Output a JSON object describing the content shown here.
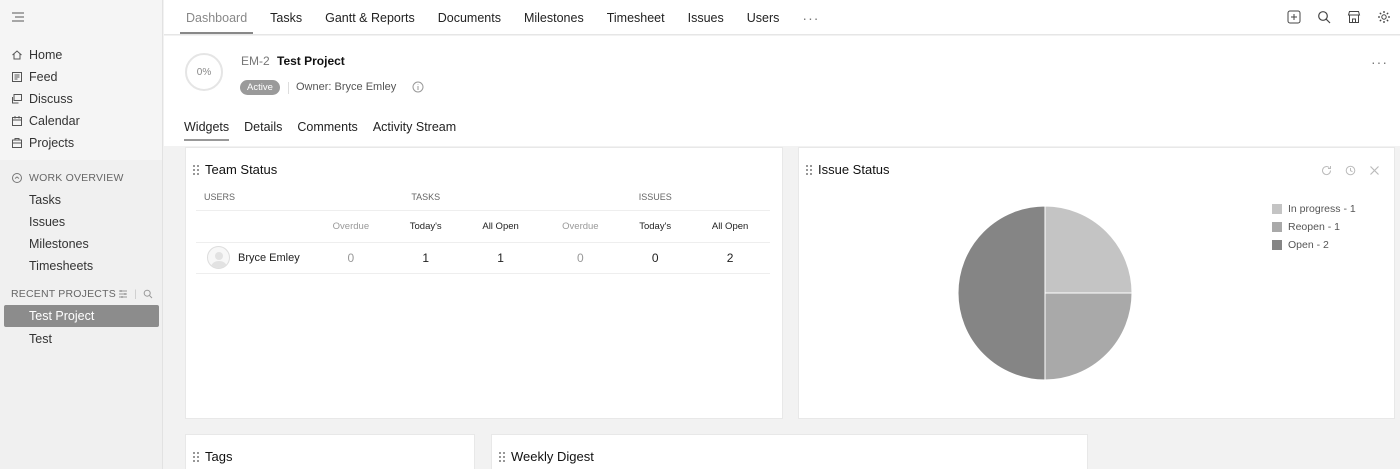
{
  "sidebar": {
    "nav": [
      {
        "label": "Home",
        "icon": "home-icon"
      },
      {
        "label": "Feed",
        "icon": "feed-icon"
      },
      {
        "label": "Discuss",
        "icon": "discuss-icon"
      },
      {
        "label": "Calendar",
        "icon": "calendar-icon"
      },
      {
        "label": "Projects",
        "icon": "projects-icon"
      }
    ],
    "work_overview": {
      "label": "WORK OVERVIEW",
      "items": [
        "Tasks",
        "Issues",
        "Milestones",
        "Timesheets"
      ]
    },
    "recent_projects": {
      "label": "RECENT PROJECTS",
      "items": [
        {
          "label": "Test Project",
          "active": true
        },
        {
          "label": "Test",
          "active": false
        }
      ]
    }
  },
  "topbar": {
    "tabs": [
      {
        "label": "Dashboard",
        "active": true
      },
      {
        "label": "Tasks"
      },
      {
        "label": "Gantt & Reports"
      },
      {
        "label": "Documents"
      },
      {
        "label": "Milestones"
      },
      {
        "label": "Timesheet"
      },
      {
        "label": "Issues"
      },
      {
        "label": "Users"
      }
    ],
    "more": "···"
  },
  "project": {
    "progress": "0%",
    "id": "EM-2",
    "name": "Test Project",
    "status": "Active",
    "owner_label": "Owner:",
    "owner": "Bryce Emley"
  },
  "subtabs": [
    {
      "label": "Widgets",
      "active": true
    },
    {
      "label": "Details"
    },
    {
      "label": "Comments"
    },
    {
      "label": "Activity Stream"
    }
  ],
  "team_status": {
    "title": "Team Status",
    "headers": {
      "users": "USERS",
      "tasks": "TASKS",
      "issues": "ISSUES"
    },
    "subheaders": [
      "Overdue",
      "Today's",
      "All Open",
      "Overdue",
      "Today's",
      "All Open"
    ],
    "rows": [
      {
        "user": "Bryce Emley",
        "values": [
          "0",
          "1",
          "1",
          "0",
          "0",
          "2"
        ]
      }
    ]
  },
  "issue_status": {
    "title": "Issue Status",
    "legend": [
      "In progress - 1",
      "Reopen - 1",
      "Open - 2"
    ]
  },
  "chart_data": {
    "type": "pie",
    "labels": [
      "In progress",
      "Reopen",
      "Open"
    ],
    "values": [
      1,
      1,
      2
    ],
    "colors": [
      "#c4c4c4",
      "#a9a9a9",
      "#858585"
    ]
  },
  "tags": {
    "title": "Tags"
  },
  "weekly_digest": {
    "title": "Weekly Digest"
  }
}
